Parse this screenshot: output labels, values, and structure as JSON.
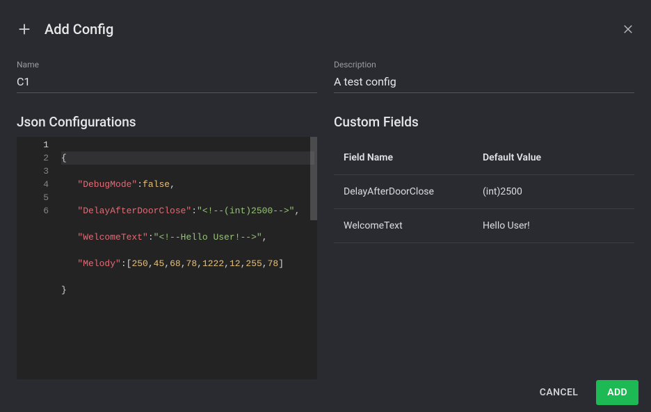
{
  "header": {
    "title": "Add Config"
  },
  "name_field": {
    "label": "Name",
    "value": "C1"
  },
  "description_field": {
    "label": "Description",
    "value": "A test config"
  },
  "json_section": {
    "title": "Json Configurations",
    "gutter": [
      "1",
      "2",
      "3",
      "4",
      "5",
      "6"
    ],
    "lines": {
      "l1": {
        "open": "{"
      },
      "l2": {
        "indent": "   ",
        "key": "\"DebugMode\"",
        "colon": ":",
        "val_bool": "false",
        "comma": ","
      },
      "l3": {
        "indent": "   ",
        "key": "\"DelayAfterDoorClose\"",
        "colon": ":",
        "val_str": "\"<!--(int)2500-->\"",
        "comma": ","
      },
      "l4": {
        "indent": "   ",
        "key": "\"WelcomeText\"",
        "colon": ":",
        "val_str": "\"<!--Hello User!-->\"",
        "comma": ","
      },
      "l5": {
        "indent": "   ",
        "key": "\"Melody\"",
        "colon": ":",
        "open": "[",
        "nums": [
          "250",
          "45",
          "68",
          "78",
          "1222",
          "12",
          "255",
          "78"
        ],
        "close": "]"
      },
      "l6": {
        "close": "}"
      }
    }
  },
  "custom_fields": {
    "title": "Custom Fields",
    "columns": {
      "c1": "Field Name",
      "c2": "Default Value"
    },
    "rows": [
      {
        "name": "DelayAfterDoorClose",
        "value": "(int)2500"
      },
      {
        "name": "WelcomeText",
        "value": "Hello User!"
      }
    ]
  },
  "footer": {
    "cancel": "CANCEL",
    "add": "ADD"
  }
}
